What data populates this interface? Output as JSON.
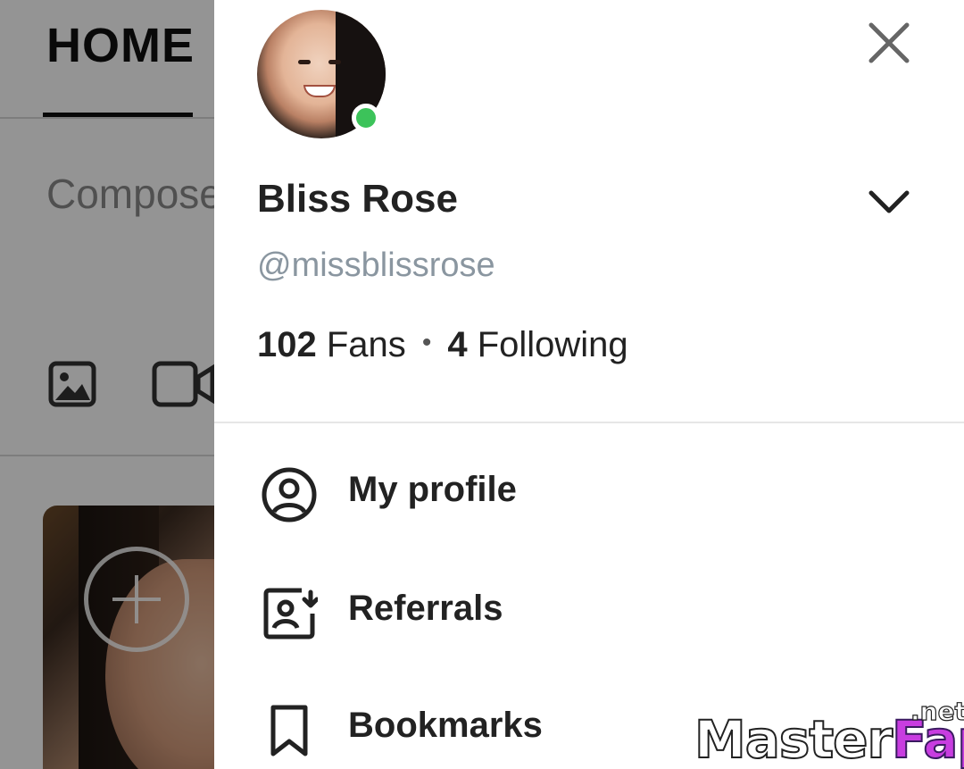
{
  "background": {
    "tab_home": "HOME",
    "compose_placeholder": "Compose",
    "icons": [
      "image-icon",
      "video-icon",
      "plus-icon"
    ]
  },
  "drawer": {
    "display_name": "Bliss Rose",
    "username": "@missblissrose",
    "fans_count": "102",
    "fans_label": "Fans",
    "separator": "•",
    "following_count": "4",
    "following_label": "Following",
    "online_status_color": "#3cc35a",
    "menu": [
      {
        "label": "My profile",
        "icon": "user-circle-icon"
      },
      {
        "label": "Referrals",
        "icon": "referral-icon"
      },
      {
        "label": "Bookmarks",
        "icon": "bookmark-icon"
      }
    ]
  },
  "watermark": {
    "main_a": "Master",
    "main_b": "Fap",
    "suffix": ".net"
  }
}
